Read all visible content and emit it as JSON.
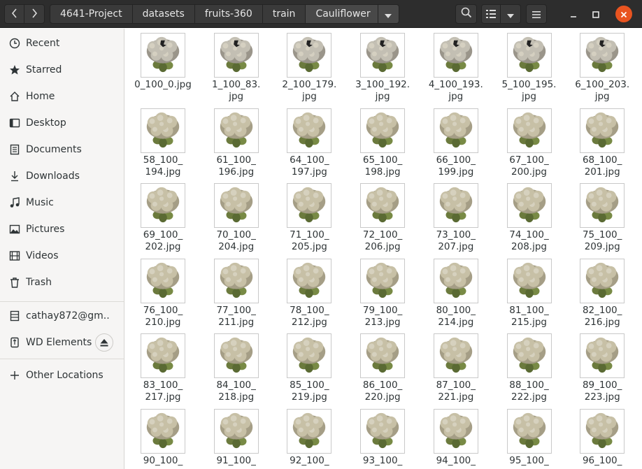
{
  "breadcrumbs": [
    "4641-Project",
    "datasets",
    "fruits-360",
    "train",
    "Cauliflower"
  ],
  "sidebar": {
    "items": [
      {
        "label": "Recent",
        "icon": "clock-icon"
      },
      {
        "label": "Starred",
        "icon": "star-icon"
      },
      {
        "label": "Home",
        "icon": "home-icon"
      },
      {
        "label": "Desktop",
        "icon": "desktop-icon"
      },
      {
        "label": "Documents",
        "icon": "document-icon"
      },
      {
        "label": "Downloads",
        "icon": "download-icon"
      },
      {
        "label": "Music",
        "icon": "music-icon"
      },
      {
        "label": "Pictures",
        "icon": "picture-icon"
      },
      {
        "label": "Videos",
        "icon": "video-icon"
      },
      {
        "label": "Trash",
        "icon": "trash-icon"
      }
    ],
    "devices": [
      {
        "label": "cathay872@gm...",
        "icon": "network-drive-icon"
      },
      {
        "label": "WD Elements",
        "icon": "usb-drive-icon"
      }
    ],
    "other": {
      "label": "Other Locations",
      "icon": "plus-icon"
    }
  },
  "files": [
    [
      "0_100_0.jpg"
    ],
    [
      "1_100_83.",
      "jpg"
    ],
    [
      "2_100_179.",
      "jpg"
    ],
    [
      "3_100_192.",
      "jpg"
    ],
    [
      "4_100_193.",
      "jpg"
    ],
    [
      "5_100_195.",
      "jpg"
    ],
    [
      "6_100_203.",
      "jpg"
    ],
    [
      "58_100_",
      "194.jpg"
    ],
    [
      "61_100_",
      "196.jpg"
    ],
    [
      "64_100_",
      "197.jpg"
    ],
    [
      "65_100_",
      "198.jpg"
    ],
    [
      "66_100_",
      "199.jpg"
    ],
    [
      "67_100_",
      "200.jpg"
    ],
    [
      "68_100_",
      "201.jpg"
    ],
    [
      "69_100_",
      "202.jpg"
    ],
    [
      "70_100_",
      "204.jpg"
    ],
    [
      "71_100_",
      "205.jpg"
    ],
    [
      "72_100_",
      "206.jpg"
    ],
    [
      "73_100_",
      "207.jpg"
    ],
    [
      "74_100_",
      "208.jpg"
    ],
    [
      "75_100_",
      "209.jpg"
    ],
    [
      "76_100_",
      "210.jpg"
    ],
    [
      "77_100_",
      "211.jpg"
    ],
    [
      "78_100_",
      "212.jpg"
    ],
    [
      "79_100_",
      "213.jpg"
    ],
    [
      "80_100_",
      "214.jpg"
    ],
    [
      "81_100_",
      "215.jpg"
    ],
    [
      "82_100_",
      "216.jpg"
    ],
    [
      "83_100_",
      "217.jpg"
    ],
    [
      "84_100_",
      "218.jpg"
    ],
    [
      "85_100_",
      "219.jpg"
    ],
    [
      "86_100_",
      "220.jpg"
    ],
    [
      "87_100_",
      "221.jpg"
    ],
    [
      "88_100_",
      "222.jpg"
    ],
    [
      "89_100_",
      "223.jpg"
    ],
    [
      "90_100_"
    ],
    [
      "91_100_"
    ],
    [
      "92_100_"
    ],
    [
      "93_100_"
    ],
    [
      "94_100_"
    ],
    [
      "95_100_"
    ],
    [
      "96_100_"
    ]
  ],
  "colors": {
    "headerbar": "#2d2d2d",
    "close_button": "#e95420",
    "sidebar_bg": "#f6f5f4",
    "text": "#2e3436"
  }
}
